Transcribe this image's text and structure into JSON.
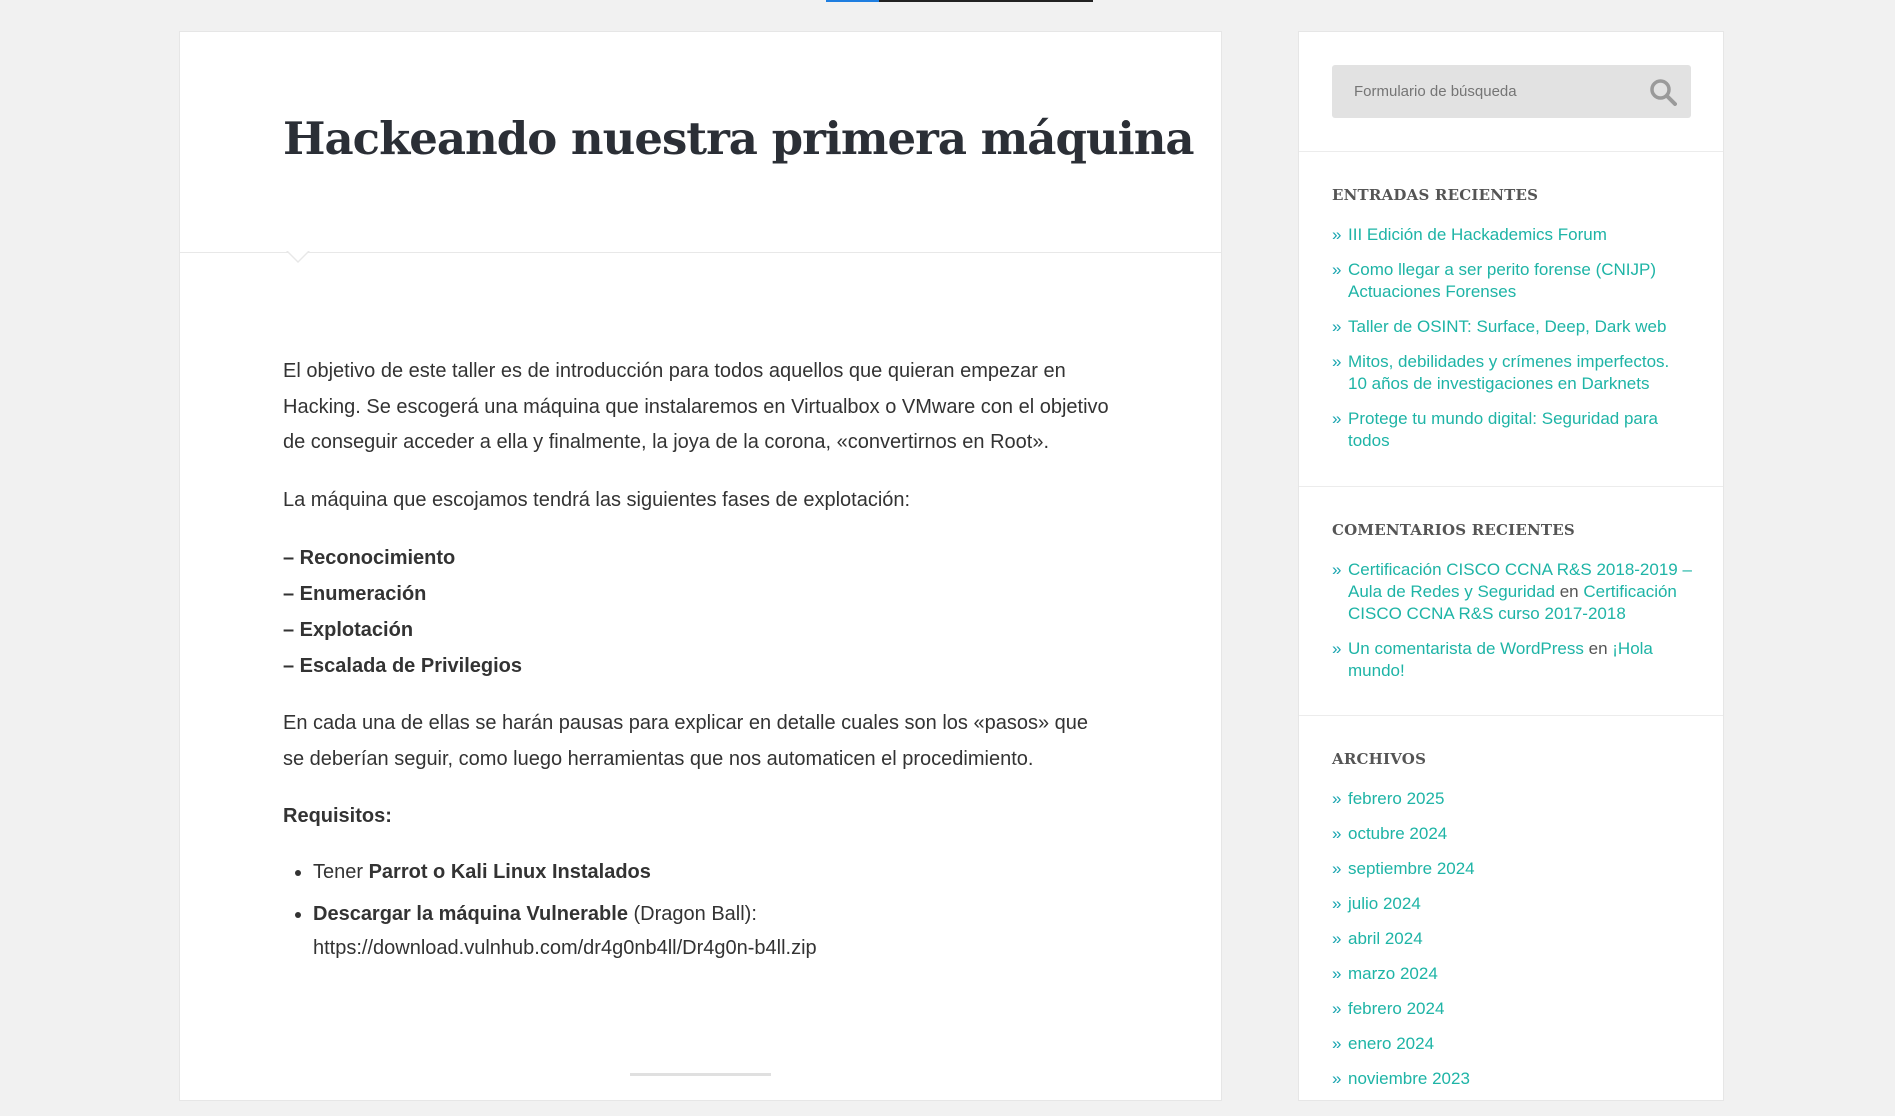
{
  "scroll_progress": 0.2,
  "colors": {
    "accent": "#1eb4a6",
    "progress": "#1f7ee0",
    "title": "#2b2f36"
  },
  "post": {
    "title": "Hackeando nuestra primera máquina",
    "intro": "El objetivo de este taller es de introducción para todos aquellos que quieran  empezar en Hacking. Se escogerá una máquina que instalaremos en Virtualbox o  VMware con el objetivo de conseguir acceder a ella y finalmente, la joya de la corona, «convertirnos en Root».",
    "phases_intro": "La máquina que escojamos tendrá las siguientes fases de explotación:",
    "phases": [
      "– Reconocimiento",
      "– Enumeración",
      "– Explotación",
      "– Escalada de Privilegios"
    ],
    "pauses": "En cada una de ellas se harán pausas para explicar en detalle cuales son los «pasos» que se deberían seguir, como luego herramientas que nos automaticen el procedimiento.",
    "requirements_title": "Requisitos:",
    "req1_prefix": "Tener ",
    "req1_bold": "Parrot o Kali Linux Instalados",
    "req2_bold": "Descargar la máquina Vulnerable",
    "req2_rest": " (Dragon Ball): https://download.vulnhub.com/dr4g0nb4ll/Dr4g0n-b4ll.zip"
  },
  "search": {
    "placeholder": "Formulario de búsqueda",
    "icon": "search-icon"
  },
  "recent_posts": {
    "title": "ENTRADAS RECIENTES",
    "items": [
      "III Edición de Hackademics Forum",
      "Como llegar a ser perito forense (CNIJP) Actuaciones Forenses",
      "Taller de OSINT: Surface, Deep, Dark web",
      "Mitos, debilidades y crímenes imperfectos. 10 años de investigaciones en Darknets",
      "Protege tu mundo digital: Seguridad para todos"
    ]
  },
  "recent_comments": {
    "title": "COMENTARIOS RECIENTES",
    "items": [
      {
        "author": "Certificación CISCO CCNA R&S 2018-2019 – Aula de Redes y Seguridad",
        "sep": " en ",
        "post": "Certificación CISCO CCNA R&S curso 2017-2018"
      },
      {
        "author": "Un comentarista de WordPress",
        "sep": " en ",
        "post": "¡Hola mundo!"
      }
    ]
  },
  "archives": {
    "title": "ARCHIVOS",
    "items": [
      "febrero 2025",
      "octubre 2024",
      "septiembre 2024",
      "julio 2024",
      "abril 2024",
      "marzo 2024",
      "febrero 2024",
      "enero 2024",
      "noviembre 2023"
    ]
  }
}
